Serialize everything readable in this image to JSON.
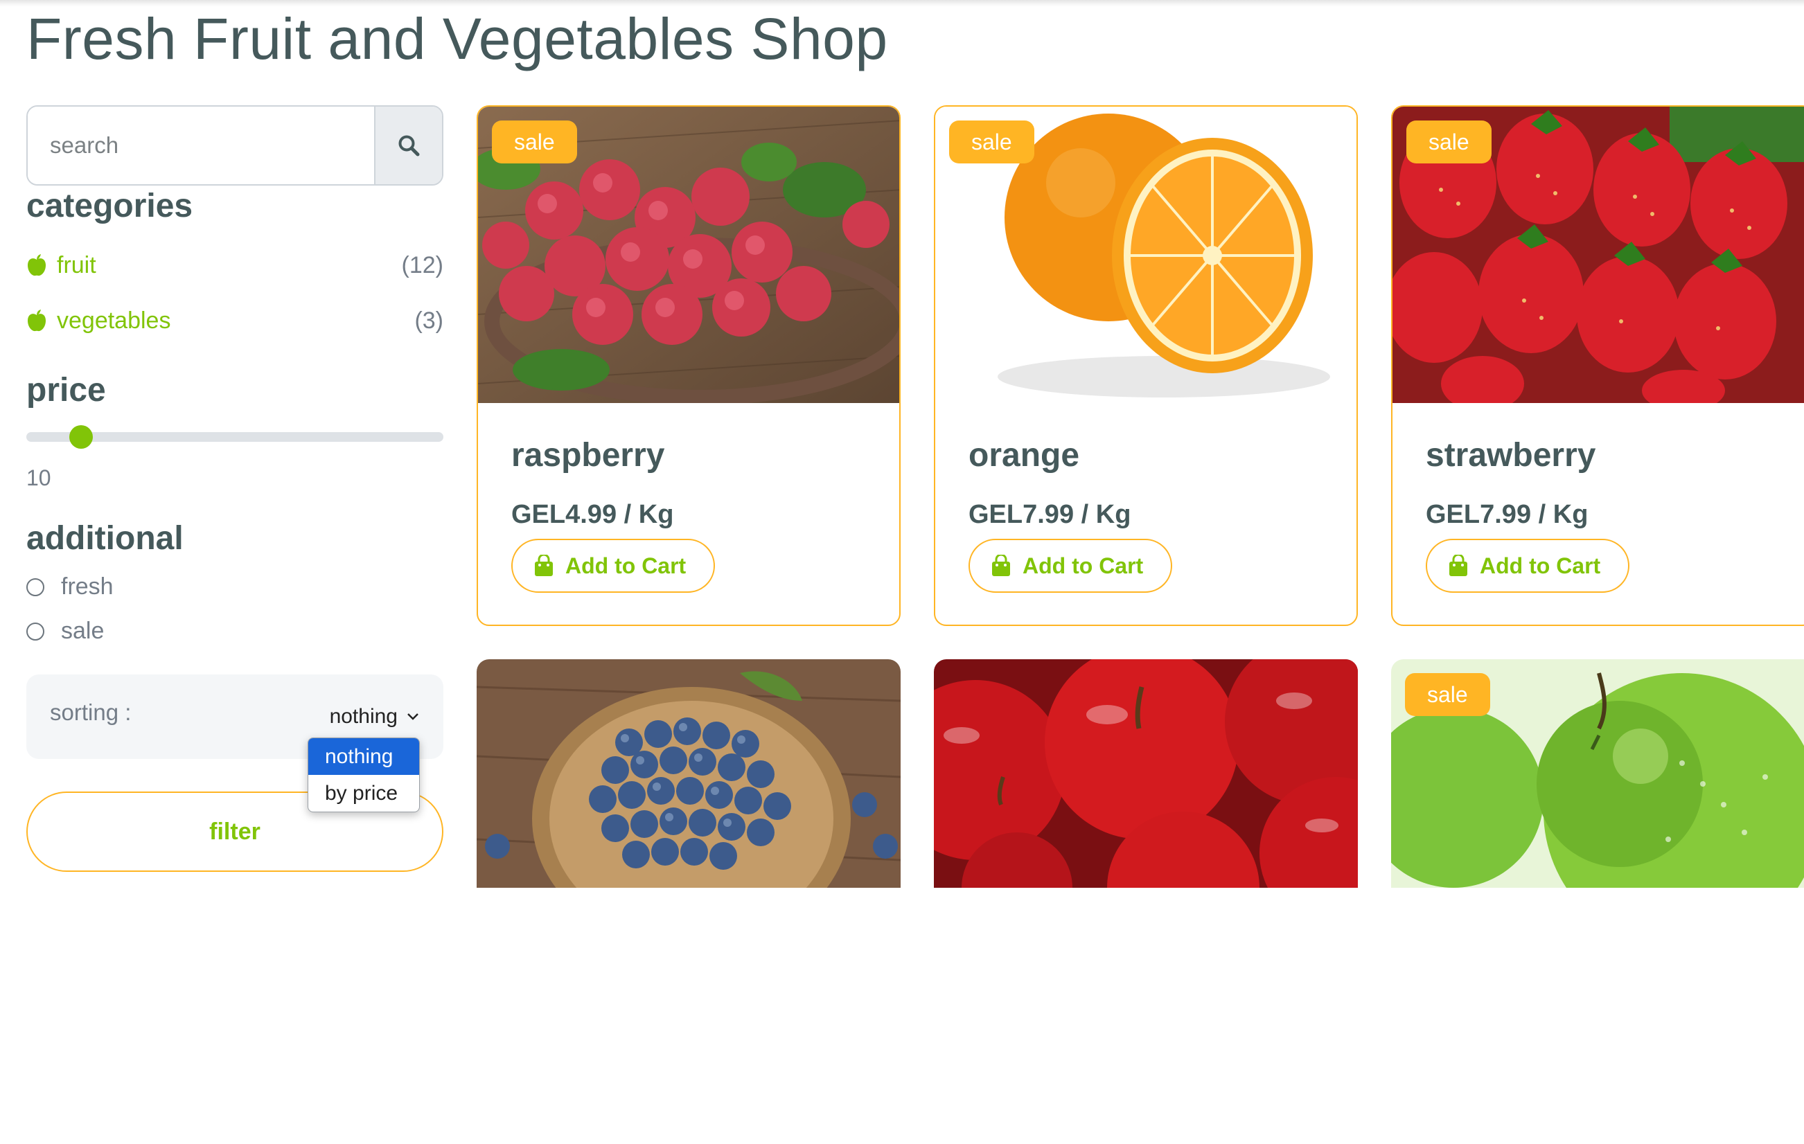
{
  "page": {
    "title": "Fresh Fruit and Vegetables Shop"
  },
  "search": {
    "placeholder": "search"
  },
  "categories": {
    "title": "categories",
    "items": [
      {
        "label": "fruit",
        "count": "(12)"
      },
      {
        "label": "vegetables",
        "count": "(3)"
      }
    ]
  },
  "price": {
    "title": "price",
    "value": "10",
    "slider_fraction": 0.08
  },
  "additional": {
    "title": "additional",
    "options": [
      {
        "label": "fresh"
      },
      {
        "label": "sale"
      }
    ]
  },
  "sorting": {
    "label": "sorting :",
    "selected": "nothing",
    "options": [
      "nothing",
      "by price"
    ]
  },
  "filter": {
    "label": "filter"
  },
  "products": [
    {
      "name": "raspberry",
      "price": "GEL4.99 / Kg",
      "badge": "sale",
      "cart_label": "Add to Cart",
      "image": "raspberry"
    },
    {
      "name": "orange",
      "price": "GEL7.99 / Kg",
      "badge": "sale",
      "cart_label": "Add to Cart",
      "image": "orange"
    },
    {
      "name": "strawberry",
      "price": "GEL7.99 / Kg",
      "badge": "sale",
      "cart_label": "Add to Cart",
      "image": "strawberry"
    },
    {
      "image": "blueberry"
    },
    {
      "image": "red-apple"
    },
    {
      "badge": "sale",
      "image": "green-apple"
    }
  ],
  "colors": {
    "accent_green": "#81c408",
    "accent_orange": "#ffb524",
    "text_dark": "#45595b"
  }
}
